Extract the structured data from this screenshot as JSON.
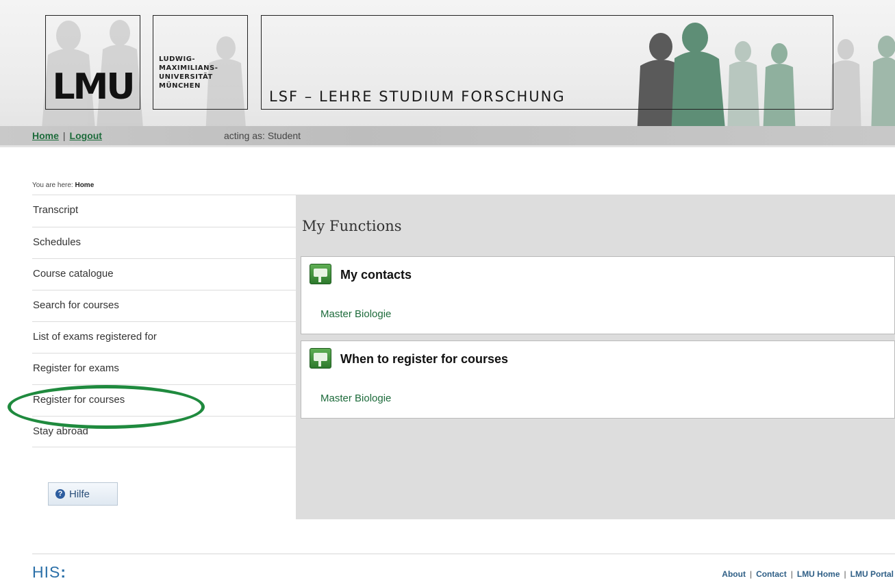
{
  "header": {
    "logo_text": "LMU",
    "university_lines": [
      "LUDWIG-",
      "MAXIMILIANS-",
      "UNIVERSITÄT",
      "MÜNCHEN"
    ],
    "site_title": "LSF – LEHRE STUDIUM FORSCHUNG"
  },
  "topbar": {
    "home_label": "Home",
    "separator": "|",
    "logout_label": "Logout",
    "acting_as": "acting as: Student"
  },
  "breadcrumb": {
    "prefix": "You are here:",
    "current": "Home"
  },
  "sidebar": {
    "items": [
      {
        "label": "Transcript"
      },
      {
        "label": "Schedules"
      },
      {
        "label": "Course catalogue"
      },
      {
        "label": "Search for courses"
      },
      {
        "label": "List of exams registered for"
      },
      {
        "label": "Register for exams"
      },
      {
        "label": "Register for courses"
      },
      {
        "label": "Stay abroad"
      }
    ],
    "help_label": "Hilfe",
    "help_icon": "question-icon"
  },
  "main": {
    "title": "My Functions",
    "boxes": [
      {
        "title": "My contacts",
        "icon": "contacts-icon",
        "link": "Master Biologie"
      },
      {
        "title": "When to register for courses",
        "icon": "calendar-icon",
        "link": "Master Biologie"
      }
    ]
  },
  "footer": {
    "logo_text": "HIS",
    "logo_colon": ":",
    "links": [
      "About",
      "Contact",
      "LMU Home",
      "LMU Portal"
    ],
    "separator": "|"
  },
  "colors": {
    "link_green": "#1d6b3b",
    "highlight_ring": "#1f8a3e",
    "panel_gray": "#dddddd",
    "footer_link_blue": "#2f5f86",
    "his_blue": "#2a6fa8"
  }
}
